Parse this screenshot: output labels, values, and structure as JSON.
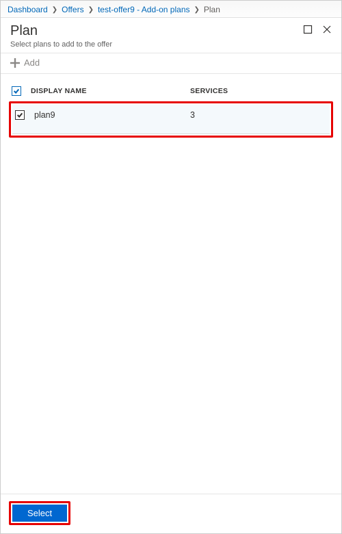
{
  "breadcrumb": {
    "items": [
      {
        "label": "Dashboard"
      },
      {
        "label": "Offers"
      },
      {
        "label": "test-offer9 - Add-on plans"
      },
      {
        "label": "Plan"
      }
    ]
  },
  "header": {
    "title": "Plan",
    "subtitle": "Select plans to add to the offer"
  },
  "toolbar": {
    "add_label": "Add"
  },
  "table": {
    "columns": {
      "display_name": "DISPLAY NAME",
      "services": "SERVICES"
    },
    "rows": [
      {
        "name": "plan9",
        "services": "3",
        "checked": true
      }
    ]
  },
  "footer": {
    "select_label": "Select"
  }
}
